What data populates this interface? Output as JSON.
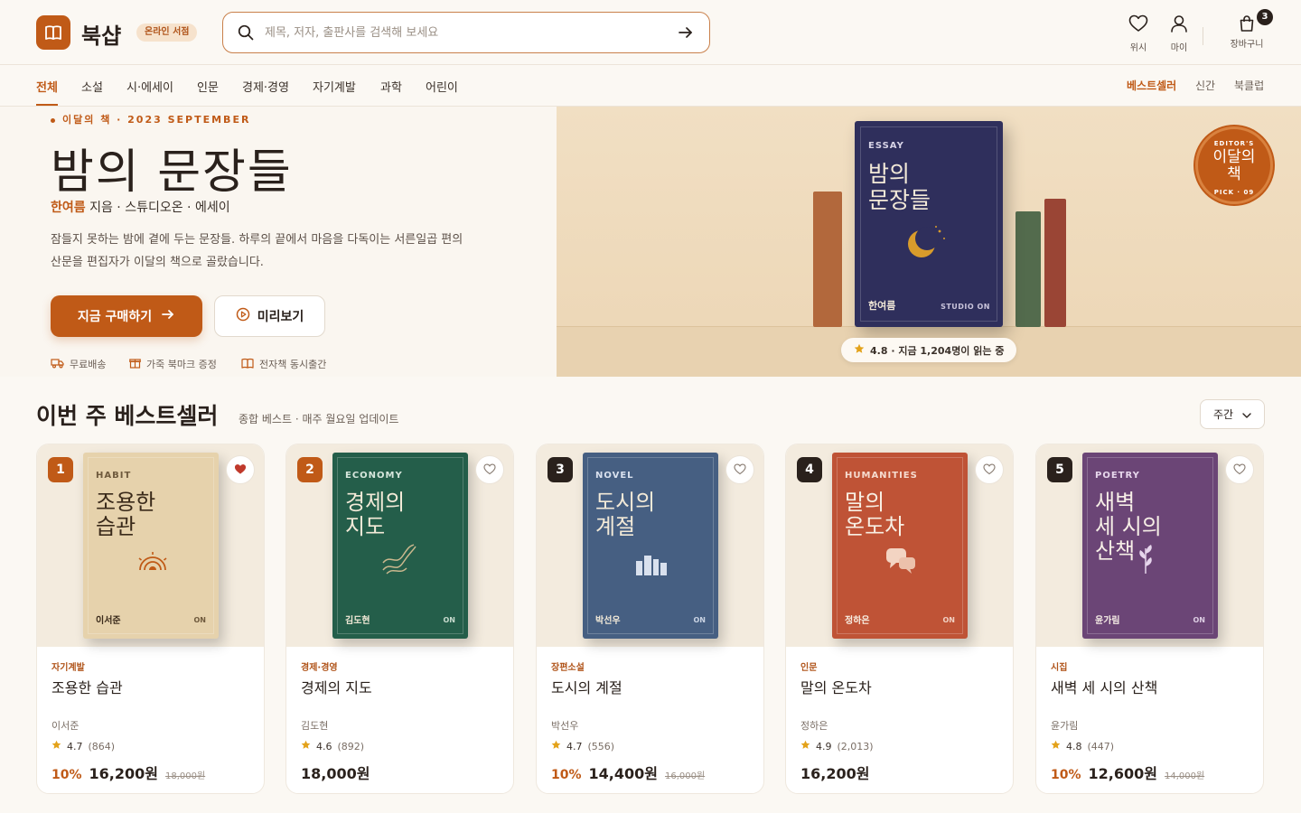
{
  "header": {
    "brand": "북샵",
    "brand_badge": "온라인 서점",
    "search_placeholder": "제목, 저자, 출판사를 검색해 보세요",
    "wish_label": "위시",
    "my_label": "마이",
    "cart_label": "장바구니",
    "cart_count": "3"
  },
  "categories": [
    "전체",
    "소설",
    "시·에세이",
    "인문",
    "경제·경영",
    "자기계발",
    "과학",
    "어린이"
  ],
  "right_nav": [
    "베스트셀러",
    "신간",
    "북클럽"
  ],
  "hero": {
    "kicker": "이달의 책 · 2023 SEPTEMBER",
    "title": "밤의 문장들",
    "author": "한여름",
    "byline_rest": " 지음 · 스튜디오온 · 에세이",
    "desc": "잠들지 못하는 밤에 곁에 두는 문장들. 하루의 끝에서 마음을 다독이는 서른일곱 편의 산문을 편집자가 이달의 책으로 골랐습니다.",
    "buy_label": "지금 구매하기",
    "preview_label": "미리보기",
    "perks": [
      "무료배송",
      "가죽 북마크 증정",
      "전자책 동시출간"
    ],
    "book": {
      "genre": "ESSAY",
      "title_l1": "밤의",
      "title_l2": "문장들",
      "author": "한여름",
      "publisher": "STUDIO ON"
    },
    "rating_text": "4.8 · 지금 1,204명이 읽는 중",
    "stamp": {
      "top": "EDITOR'S",
      "l1": "이달의",
      "l2": "책",
      "bottom": "PICK · 09"
    }
  },
  "bestseller": {
    "title": "이번 주 베스트셀러",
    "subtitle": "종합 베스트 · 매주 월요일 업데이트",
    "period": "주간",
    "items": [
      {
        "rank": "1",
        "genre": "HABIT",
        "cover_l1": "조용한",
        "cover_l2": "습관",
        "category": "자기계발",
        "title": "조용한 습관",
        "author": "이서준",
        "rating": "4.7",
        "count": "(864)",
        "discount": "10%",
        "price": "16,200원",
        "original": "18,000원",
        "cover_color": "#e6d2ac",
        "liked": true
      },
      {
        "rank": "2",
        "genre": "ECONOMY",
        "cover_l1": "경제의",
        "cover_l2": "지도",
        "category": "경제·경영",
        "title": "경제의 지도",
        "author": "김도현",
        "rating": "4.6",
        "count": "(892)",
        "discount": "",
        "price": "18,000원",
        "original": "",
        "cover_color": "#245e4a",
        "liked": false
      },
      {
        "rank": "3",
        "genre": "NOVEL",
        "cover_l1": "도시의",
        "cover_l2": "계절",
        "category": "장편소설",
        "title": "도시의 계절",
        "author": "박선우",
        "rating": "4.7",
        "count": "(556)",
        "discount": "10%",
        "price": "14,400원",
        "original": "16,000원",
        "cover_color": "#465f82",
        "liked": false
      },
      {
        "rank": "4",
        "genre": "HUMANITIES",
        "cover_l1": "말의",
        "cover_l2": "온도차",
        "category": "인문",
        "title": "말의 온도차",
        "author": "정하은",
        "rating": "4.9",
        "count": "(2,013)",
        "discount": "",
        "price": "16,200원",
        "original": "",
        "cover_color": "#bf5336",
        "liked": false
      },
      {
        "rank": "5",
        "genre": "POETRY",
        "cover_l1": "새벽",
        "cover_l2": "세 시의",
        "cover_l3": "산책",
        "category": "시집",
        "title": "새벽 세 시의 산책",
        "author": "윤가림",
        "rating": "4.8",
        "count": "(447)",
        "discount": "10%",
        "price": "12,600원",
        "original": "14,000원",
        "cover_color": "#6b4576",
        "liked": false
      }
    ]
  },
  "colors": {
    "accent": "#c05a17",
    "text": "#2a211c",
    "star": "#e3a21a"
  }
}
